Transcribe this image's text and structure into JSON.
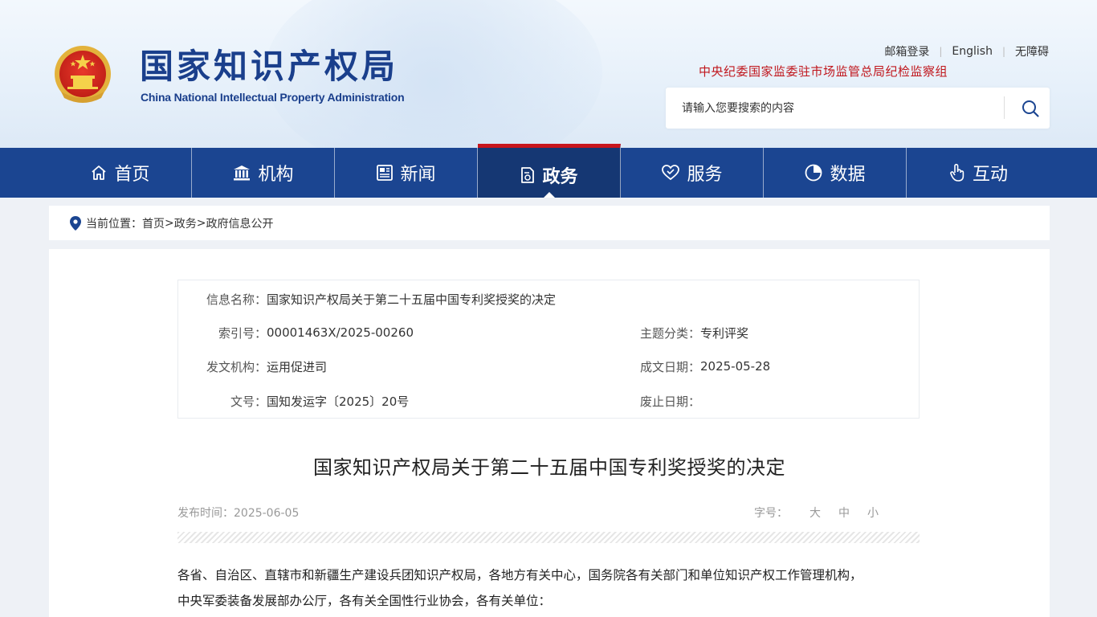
{
  "header": {
    "logo_cn": "国家知识产权局",
    "logo_en": "China National Intellectual Property Administration",
    "top_links": [
      "邮箱登录",
      "English",
      "无障碍"
    ],
    "discipline": "中央纪委国家监委驻市场监管总局纪检监察组",
    "search_placeholder": "请输入您要搜索的内容"
  },
  "nav": {
    "items": [
      {
        "label": "首页",
        "icon": "home-icon"
      },
      {
        "label": "机构",
        "icon": "institution-icon"
      },
      {
        "label": "新闻",
        "icon": "news-icon"
      },
      {
        "label": "政务",
        "icon": "government-affairs-icon",
        "active": true
      },
      {
        "label": "服务",
        "icon": "service-icon"
      },
      {
        "label": "数据",
        "icon": "data-icon"
      },
      {
        "label": "互动",
        "icon": "interaction-icon"
      }
    ]
  },
  "breadcrumb": {
    "prefix": "当前位置：",
    "items": [
      "首页",
      "政务",
      "政府信息公开"
    ],
    "sep": ">"
  },
  "info": {
    "name_label": "信息名称：",
    "name_value": "国家知识产权局关于第二十五届中国专利奖授奖的决定",
    "index_label": "索引号：",
    "index_value": "00001463X/2025-00260",
    "topic_label": "主题分类：",
    "topic_value": "专利评奖",
    "issuer_label": "发文机构：",
    "issuer_value": "运用促进司",
    "date_label": "成文日期：",
    "date_value": "2025-05-28",
    "docno_label": "文号：",
    "docno_value": "国知发运字〔2025〕20号",
    "abolish_label": "废止日期：",
    "abolish_value": ""
  },
  "article": {
    "title": "国家知识产权局关于第二十五届中国专利奖授奖的决定",
    "publish_label": "发布时间：",
    "publish_date": "2025-06-05",
    "fontsize_label": "字号：",
    "fontsize_options": [
      "大",
      "中",
      "小"
    ],
    "body_line1": "各省、自治区、直辖市和新疆生产建设兵团知识产权局，各地方有关中心，国务院各有关部门和单位知识产权工作管理机构，",
    "body_line2": "中央军委装备发展部办公厅，各有关全国性行业协会，各有关单位："
  },
  "colors": {
    "brand_blue": "#1b4591",
    "active_red": "#c8161d",
    "discipline_red": "#c0161c"
  }
}
